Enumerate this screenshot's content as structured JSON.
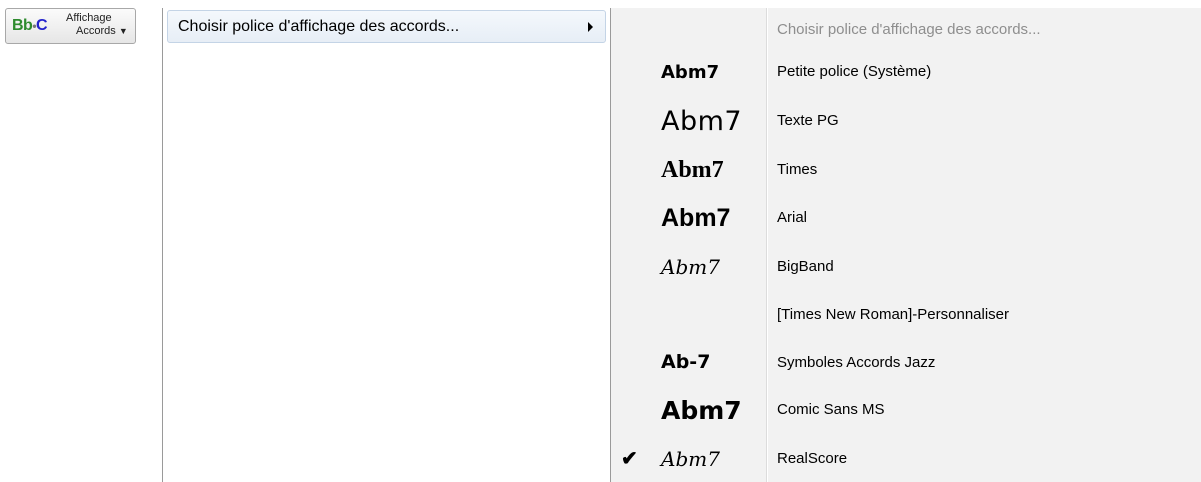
{
  "toolbar": {
    "icon_bb": "Bb",
    "icon_dot": "•",
    "icon_c": "C",
    "label_line1": "Affichage",
    "label_line2": "Accords",
    "dropdown_arrow": "▼"
  },
  "menu": {
    "item_label": "Choisir police d'affichage des accords..."
  },
  "submenu": {
    "header": "Choisir police d'affichage des accords...",
    "check_mark": "✔",
    "items": [
      {
        "preview": "Abm7",
        "label": "Petite police (Système)"
      },
      {
        "preview": "Abm7",
        "label": "Texte PG"
      },
      {
        "preview": "Abm7",
        "label": "Times"
      },
      {
        "preview": "Abm7",
        "label": "Arial"
      },
      {
        "preview": "Abm7",
        "label": "BigBand"
      },
      {
        "preview": "",
        "label": "[Times New Roman]-Personnaliser"
      },
      {
        "preview": "Ab-7",
        "label": "Symboles Accords Jazz"
      },
      {
        "preview": "Abm7",
        "label": "Comic Sans MS"
      },
      {
        "preview": "Abm7",
        "label": "RealScore",
        "checked": true
      }
    ]
  },
  "colors": {
    "bb": "#2e8b2e",
    "c": "#2222cc",
    "disabled_text": "#8e8e8e",
    "submenu_bg": "#f2f2f2",
    "highlight_border": "#c4d4e6"
  }
}
